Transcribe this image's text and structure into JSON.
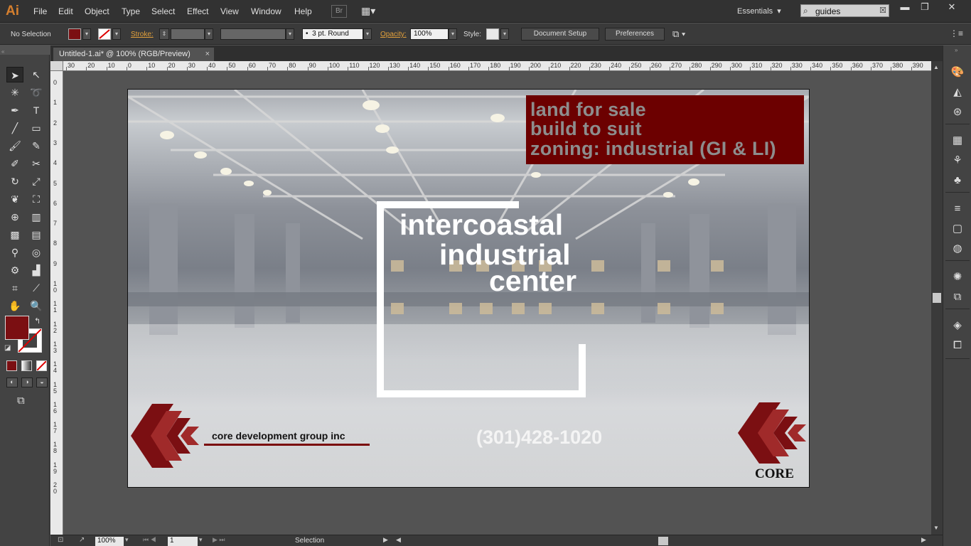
{
  "app": {
    "logo": "Ai",
    "menus": [
      "File",
      "Edit",
      "Object",
      "Type",
      "Select",
      "Effect",
      "View",
      "Window",
      "Help"
    ],
    "bridge": "Br",
    "workspace": "Essentials",
    "search_value": "guides"
  },
  "control_bar": {
    "selection": "No Selection",
    "stroke_label": "Stroke:",
    "brush": "3 pt. Round",
    "opacity_label": "Opacity:",
    "opacity_value": "100%",
    "style_label": "Style:",
    "document_setup": "Document Setup",
    "preferences": "Preferences"
  },
  "document": {
    "tab_title": "Untitled-1.ai* @ 100% (RGB/Preview)",
    "close_glyph": "×"
  },
  "ruler": {
    "h_ticks": [
      "30",
      "20",
      "10",
      "0",
      "10",
      "20",
      "30",
      "40",
      "50",
      "60",
      "70",
      "80",
      "90",
      "100",
      "110",
      "120",
      "130",
      "140",
      "150",
      "160",
      "170",
      "180",
      "190",
      "200",
      "210",
      "220",
      "230",
      "240",
      "250",
      "260",
      "270",
      "280",
      "290",
      "300",
      "310",
      "320",
      "330",
      "340",
      "350",
      "360",
      "370",
      "380",
      "390"
    ],
    "v_ticks": [
      "0",
      "1",
      "2",
      "3",
      "4",
      "5",
      "6",
      "7",
      "8",
      "9",
      "1 0",
      "1 1",
      "1 2",
      "1 3",
      "1 4",
      "1 5",
      "1 6",
      "1 7",
      "1 8",
      "1 9",
      "2 0"
    ]
  },
  "artwork": {
    "banner_lines": [
      "land for sale",
      "build to suit",
      "zoning: industrial (GI & LI)"
    ],
    "title_lines": [
      "intercoastal",
      "industrial",
      "center"
    ],
    "phone": "(301)428-1020",
    "company": "core development group inc",
    "core_logo_text": "CORE"
  },
  "status_bar": {
    "zoom": "100%",
    "artboard": "1",
    "tool": "Selection"
  },
  "colors": {
    "fill": "#7b0f12",
    "banner": "#6c0000",
    "accent_link": "#e2a03b"
  }
}
